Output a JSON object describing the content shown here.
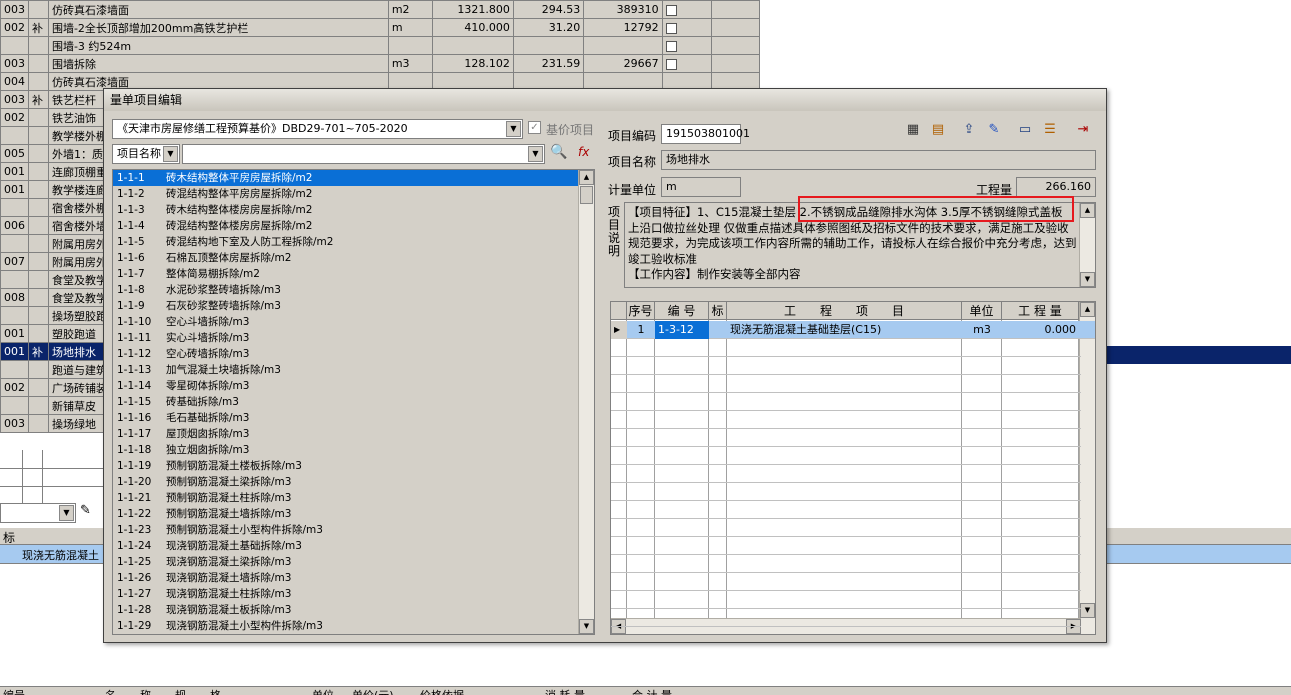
{
  "background_rows": [
    {
      "code": "003",
      "bu": "",
      "name": "仿砖真石漆墙面",
      "unit": "m2",
      "qty": "1321.800",
      "price": "294.53",
      "total": "389310",
      "check": true,
      "cls": "gray"
    },
    {
      "code": "002",
      "bu": "补",
      "name": "围墙-2全长顶部增加200mm高铁艺护栏",
      "unit": "m",
      "qty": "410.000",
      "price": "31.20",
      "total": "12792",
      "check": true,
      "cls": "gray"
    },
    {
      "code": "",
      "bu": "",
      "name": "围墙-3 约524m",
      "unit": "",
      "qty": "",
      "price": "",
      "total": "",
      "check": true,
      "cls": "gray"
    },
    {
      "code": "003",
      "bu": "",
      "name": "围墙拆除",
      "unit": "m3",
      "qty": "128.102",
      "price": "231.59",
      "total": "29667",
      "check": true,
      "cls": "gray"
    },
    {
      "code": "004",
      "bu": "",
      "name": "仿砖真石漆墙面",
      "unit": "",
      "qty": "",
      "price": "",
      "total": "",
      "check": false,
      "cls": "gray"
    },
    {
      "code": "003",
      "bu": "补",
      "name": "铁艺栏杆",
      "unit": "",
      "qty": "",
      "price": "",
      "total": "",
      "check": false,
      "cls": "gray"
    },
    {
      "code": "002",
      "bu": "",
      "name": "铁艺油饰",
      "unit": "",
      "qty": "",
      "price": "",
      "total": "",
      "check": false,
      "cls": "gray"
    },
    {
      "code": "",
      "bu": "",
      "name": "教学楼外棚",
      "unit": "",
      "qty": "",
      "price": "",
      "total": "",
      "check": false,
      "cls": "gray"
    },
    {
      "code": "005",
      "bu": "",
      "name": "外墙1：质感",
      "unit": "",
      "qty": "",
      "price": "",
      "total": "",
      "check": false,
      "cls": "gray"
    },
    {
      "code": "001",
      "bu": "",
      "name": "连廊顶棚重",
      "unit": "",
      "qty": "",
      "price": "",
      "total": "",
      "check": false,
      "cls": "gray"
    },
    {
      "code": "001",
      "bu": "",
      "name": "教学楼连廊",
      "unit": "",
      "qty": "",
      "price": "",
      "total": "",
      "check": false,
      "cls": "gray"
    },
    {
      "code": "",
      "bu": "",
      "name": "宿舍楼外棚",
      "unit": "",
      "qty": "",
      "price": "",
      "total": "",
      "check": false,
      "cls": "gray"
    },
    {
      "code": "006",
      "bu": "",
      "name": "宿舍楼外墙",
      "unit": "",
      "qty": "",
      "price": "",
      "total": "",
      "check": false,
      "cls": "gray"
    },
    {
      "code": "",
      "bu": "",
      "name": "附属用房外",
      "unit": "",
      "qty": "",
      "price": "",
      "total": "",
      "check": false,
      "cls": "gray"
    },
    {
      "code": "007",
      "bu": "",
      "name": "附属用房外",
      "unit": "",
      "qty": "",
      "price": "",
      "total": "",
      "check": false,
      "cls": "gray"
    },
    {
      "code": "",
      "bu": "",
      "name": "食堂及教学",
      "unit": "",
      "qty": "",
      "price": "",
      "total": "",
      "check": false,
      "cls": "gray"
    },
    {
      "code": "008",
      "bu": "",
      "name": "食堂及教学",
      "unit": "",
      "qty": "",
      "price": "",
      "total": "",
      "check": false,
      "cls": "gray"
    },
    {
      "code": "",
      "bu": "",
      "name": "操场塑胶跑",
      "unit": "",
      "qty": "",
      "price": "",
      "total": "",
      "check": false,
      "cls": "gray"
    },
    {
      "code": "001",
      "bu": "",
      "name": "塑胶跑道",
      "unit": "",
      "qty": "",
      "price": "",
      "total": "",
      "check": false,
      "cls": "gray"
    },
    {
      "code": "001",
      "bu": "补",
      "name": "场地排水",
      "unit": "",
      "qty": "",
      "price": "",
      "total": "",
      "check": false,
      "cls": "sel"
    },
    {
      "code": "",
      "bu": "",
      "name": "跑道与建筑",
      "unit": "",
      "qty": "",
      "price": "",
      "total": "",
      "check": false,
      "cls": "gray"
    },
    {
      "code": "002",
      "bu": "",
      "name": "广场砖铺装",
      "unit": "",
      "qty": "",
      "price": "",
      "total": "",
      "check": false,
      "cls": "gray"
    },
    {
      "code": "",
      "bu": "",
      "name": "新铺草皮",
      "unit": "",
      "qty": "",
      "price": "",
      "total": "",
      "check": false,
      "cls": "gray"
    },
    {
      "code": "003",
      "bu": "",
      "name": "操场绿地",
      "unit": "",
      "qty": "",
      "price": "",
      "total": "",
      "check": false,
      "cls": "gray"
    }
  ],
  "lower_panel": {
    "col_biao": "标",
    "row_text": "现浇无筋混凝土",
    "footer_headers": [
      "编号",
      "名",
      "称",
      "规",
      "格",
      "单位",
      "单价(元)",
      "价格依据",
      "消 耗 量",
      "合 计 量"
    ]
  },
  "dialog": {
    "title": "量单项目编辑",
    "quota_combo": "《天津市房屋修缮工程预算基价》DBD29-701~705-2020",
    "base_price_label": "基价项目",
    "search_field_label": "项目名称",
    "search_value": "",
    "list": [
      {
        "code": "1-1-1",
        "name": "砖木结构整体平房房屋拆除/m2"
      },
      {
        "code": "1-1-2",
        "name": "砖混结构整体平房房屋拆除/m2"
      },
      {
        "code": "1-1-3",
        "name": "砖木结构整体楼房房屋拆除/m2"
      },
      {
        "code": "1-1-4",
        "name": "砖混结构整体楼房房屋拆除/m2"
      },
      {
        "code": "1-1-5",
        "name": "砖混结构地下室及人防工程拆除/m2"
      },
      {
        "code": "1-1-6",
        "name": "石棉瓦顶整体房屋拆除/m2"
      },
      {
        "code": "1-1-7",
        "name": "整体简易棚拆除/m2"
      },
      {
        "code": "1-1-8",
        "name": "水泥砂浆整砖墙拆除/m3"
      },
      {
        "code": "1-1-9",
        "name": "石灰砂浆整砖墙拆除/m3"
      },
      {
        "code": "1-1-10",
        "name": "空心斗墙拆除/m3"
      },
      {
        "code": "1-1-11",
        "name": "实心斗墙拆除/m3"
      },
      {
        "code": "1-1-12",
        "name": "空心砖墙拆除/m3"
      },
      {
        "code": "1-1-13",
        "name": "加气混凝土块墙拆除/m3"
      },
      {
        "code": "1-1-14",
        "name": "零星砌体拆除/m3"
      },
      {
        "code": "1-1-15",
        "name": "砖基础拆除/m3"
      },
      {
        "code": "1-1-16",
        "name": "毛石基础拆除/m3"
      },
      {
        "code": "1-1-17",
        "name": "屋顶烟囱拆除/m3"
      },
      {
        "code": "1-1-18",
        "name": "独立烟囱拆除/m3"
      },
      {
        "code": "1-1-19",
        "name": "预制钢筋混凝土楼板拆除/m3"
      },
      {
        "code": "1-1-20",
        "name": "预制钢筋混凝土梁拆除/m3"
      },
      {
        "code": "1-1-21",
        "name": "预制钢筋混凝土柱拆除/m3"
      },
      {
        "code": "1-1-22",
        "name": "预制钢筋混凝土墙拆除/m3"
      },
      {
        "code": "1-1-23",
        "name": "预制钢筋混凝土小型构件拆除/m3"
      },
      {
        "code": "1-1-24",
        "name": "现浇钢筋混凝土基础拆除/m3"
      },
      {
        "code": "1-1-25",
        "name": "现浇钢筋混凝土梁拆除/m3"
      },
      {
        "code": "1-1-26",
        "name": "现浇钢筋混凝土墙拆除/m3"
      },
      {
        "code": "1-1-27",
        "name": "现浇钢筋混凝土柱拆除/m3"
      },
      {
        "code": "1-1-28",
        "name": "现浇钢筋混凝土板拆除/m3"
      },
      {
        "code": "1-1-29",
        "name": "现浇钢筋混凝土小型构件拆除/m3"
      }
    ],
    "selected_index": 0,
    "item_code_label": "项目编码",
    "item_code": "191503801001",
    "item_name_label": "项目名称",
    "item_name": "场地排水",
    "unit_label": "计量单位",
    "unit": "m",
    "qty_label": "工程量",
    "qty": "266.160",
    "desc_label": "项目说明",
    "description": "【项目特征】1、C15混凝土垫层 2.不锈钢成品缝隙排水沟体 3.5厚不锈钢缝隙式盖板 上沿口做拉丝处理 仅做重点描述具体参照图纸及招标文件的技术要求，满足施工及验收规范要求，为完成该项工作内容所需的辅助工作，请投标人在综合报价中充分考虑，达到竣工验收标准",
    "description2": "【工作内容】制作安装等全部内容",
    "grid_headers": [
      "序号",
      "编 号",
      "标",
      "工　　程　　项　　目",
      "单位",
      "工 程 量"
    ],
    "grid_rows": [
      {
        "seq": "1",
        "code": "1-3-12",
        "flag": "",
        "name": "现浇无筋混凝土基础垫层(C15)",
        "unit": "m3",
        "qty": "0.000"
      }
    ],
    "toolbar_icons": [
      "calculator-icon",
      "table-icon",
      "export-icon",
      "edit-pen-icon",
      "window-icon",
      "list-icon",
      "exit-icon"
    ]
  }
}
